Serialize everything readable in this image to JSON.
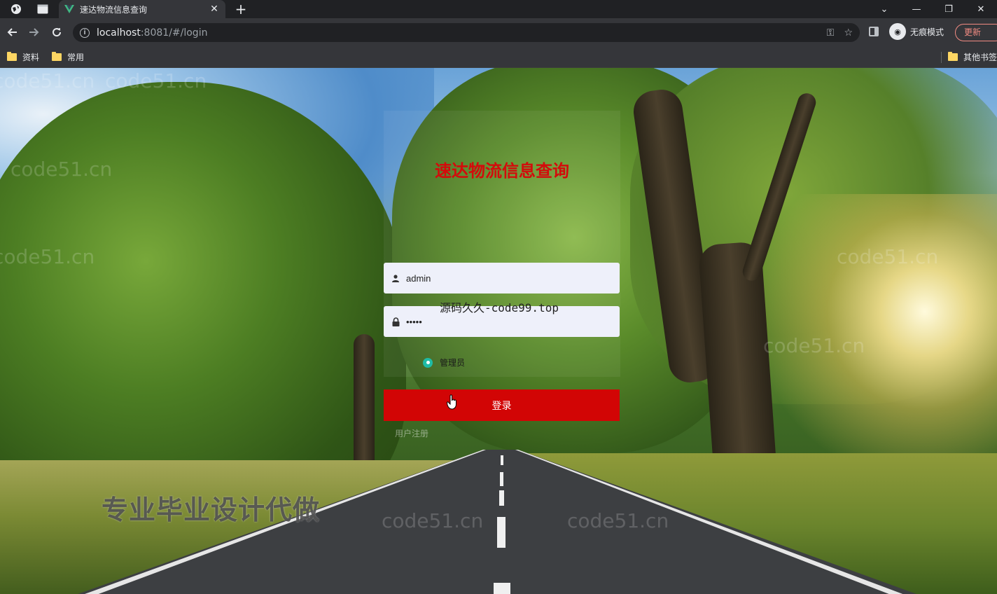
{
  "browser": {
    "tab_title": "速达物流信息查询",
    "url_host": "localhost",
    "url_rest": ":8081/#/login",
    "incognito_label": "无痕模式",
    "update_label": "更新",
    "bookmarks": [
      "资料",
      "常用"
    ],
    "other_bookmarks": "其他书签"
  },
  "watermarks": {
    "repeat_text": "code51.cn",
    "center_text": "源码久久-code99.top",
    "bottom_text": "专业毕业设计代做"
  },
  "login": {
    "title": "速达物流信息查询",
    "username_value": "admin",
    "password_value": "•••••",
    "role_label": "管理员",
    "submit_label": "登录",
    "register_label": "用户注册"
  },
  "colors": {
    "title_red": "#d30b0b",
    "button_red": "#d20505",
    "radio_teal": "#1fbba6"
  }
}
